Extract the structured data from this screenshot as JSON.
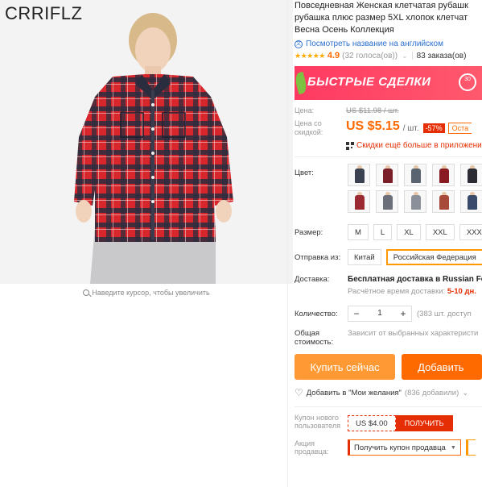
{
  "brand": "CRRIFLZ",
  "zoom_hint": "Наведите курсор, чтобы увеличить",
  "product": {
    "title_lines": [
      "Повседневная Женская клетчатая рубашк",
      "рубашка плюс размер 5XL хлопок клетчат",
      "Весна Осень Коллекция"
    ],
    "translate_link": "Посмотреть название на английском",
    "stars": "★★★★★",
    "rating": "4.9",
    "votes": "(32 голоса(ов))",
    "orders": "83 заказа(ов)"
  },
  "banner": {
    "text": "БЫСТРЫЕ СДЕЛКИ",
    "clock_text": "30"
  },
  "price": {
    "label_old": "Цена:",
    "old_price": "US $11.98 / шт.",
    "label_discount": "Цена со скидкой:",
    "current_price": "US $5.15",
    "per_unit": "/ шт.",
    "discount": "-57%",
    "remaining": "Оста",
    "app_text": "Скидки ещё больше в приложени"
  },
  "options": {
    "color_label": "Цвет:",
    "colors": [
      "#3b4150",
      "#7a1f2a",
      "#5a6470",
      "#8a1a22",
      "#2b2b33",
      "#9b2a33",
      "#6b6f7a",
      "#8a8f99",
      "#a84a3a",
      "#3a4a6a"
    ],
    "size_label": "Размер:",
    "sizes": [
      "M",
      "L",
      "XL",
      "XXL",
      "XXXL"
    ],
    "ship_from_label": "Отправка из:",
    "ship_from": [
      "Китай",
      "Российская Федерация"
    ]
  },
  "delivery": {
    "label": "Доставка:",
    "free_text": "Бесплатная доставка в Russian Fed",
    "time_prefix": "Расчётное время доставки:",
    "days": "5-10",
    "days_suffix": "дн."
  },
  "quantity": {
    "label": "Количество:",
    "minus": "−",
    "value": "1",
    "plus": "+",
    "available": "(383 шт. доступ"
  },
  "total": {
    "label": "Общая стоимость:",
    "value": "Зависит от выбранных характеристи"
  },
  "buttons": {
    "buy": "Купить сейчас",
    "cart": "Добавить"
  },
  "wishlist": {
    "icon": "heart-icon",
    "text": "Добавить в \"Мои желания\"",
    "count": "(836 добавили)",
    "chevron": "⌄"
  },
  "coupon": {
    "label": "Купон нового пользователя",
    "amount": "US $4.00",
    "get": "ПОЛУЧИТЬ"
  },
  "seller_promo": {
    "label": "Акция продавца:",
    "select": "Получить купон продавца"
  }
}
